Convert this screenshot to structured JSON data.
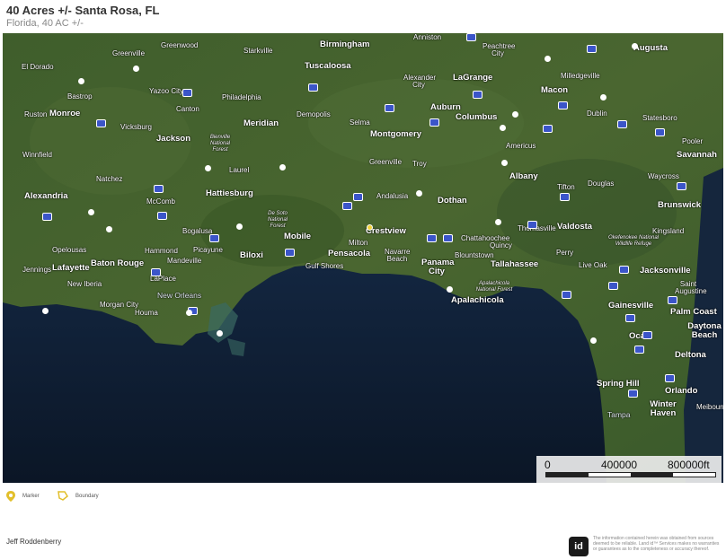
{
  "header": {
    "title": "40 Acres +/- Santa Rosa, FL",
    "subtitle": "Florida, 40 AC +/-"
  },
  "map": {
    "cities_major": [
      {
        "name": "Birmingham"
      },
      {
        "name": "Augusta"
      },
      {
        "name": "Tuscaloosa"
      },
      {
        "name": "LaGrange"
      },
      {
        "name": "Macon"
      },
      {
        "name": "Monroe"
      },
      {
        "name": "Meridian"
      },
      {
        "name": "Auburn"
      },
      {
        "name": "Columbus"
      },
      {
        "name": "Jackson"
      },
      {
        "name": "Montgomery"
      },
      {
        "name": "Savannah"
      },
      {
        "name": "Hattiesburg"
      },
      {
        "name": "Alexandria"
      },
      {
        "name": "Albany"
      },
      {
        "name": "Dothan"
      },
      {
        "name": "Brunswick"
      },
      {
        "name": "Crestview"
      },
      {
        "name": "Mobile"
      },
      {
        "name": "Valdosta"
      },
      {
        "name": "Pensacola"
      },
      {
        "name": "Baton Rouge"
      },
      {
        "name": "Lafayette"
      },
      {
        "name": "Biloxi"
      },
      {
        "name": "Panama City"
      },
      {
        "name": "Tallahassee"
      },
      {
        "name": "Jacksonville"
      },
      {
        "name": "New Orleans"
      },
      {
        "name": "Apalachicola"
      },
      {
        "name": "Gainesville"
      },
      {
        "name": "Palm Coast"
      },
      {
        "name": "Daytona Beach"
      },
      {
        "name": "Ocala"
      },
      {
        "name": "Deltona"
      },
      {
        "name": "Spring Hill"
      },
      {
        "name": "Orlando"
      },
      {
        "name": "Winter Haven"
      },
      {
        "name": "Tampa"
      }
    ],
    "cities_minor": [
      {
        "name": "Anniston"
      },
      {
        "name": "Greenwood"
      },
      {
        "name": "Peachtree City"
      },
      {
        "name": "Greenville"
      },
      {
        "name": "Starkville"
      },
      {
        "name": "El Dorado"
      },
      {
        "name": "Bastrop"
      },
      {
        "name": "Yazoo City"
      },
      {
        "name": "Philadelphia"
      },
      {
        "name": "Canton"
      },
      {
        "name": "Ruston"
      },
      {
        "name": "Vicksburg"
      },
      {
        "name": "Demopolis"
      },
      {
        "name": "Selma"
      },
      {
        "name": "Alexander City"
      },
      {
        "name": "Milledgeville"
      },
      {
        "name": "Dublin"
      },
      {
        "name": "Statesboro"
      },
      {
        "name": "Americus"
      },
      {
        "name": "Pooler"
      },
      {
        "name": "Winnfield"
      },
      {
        "name": "Natchez"
      },
      {
        "name": "Laurel"
      },
      {
        "name": "Greenville"
      },
      {
        "name": "Troy"
      },
      {
        "name": "Tifton"
      },
      {
        "name": "Douglas"
      },
      {
        "name": "Waycross"
      },
      {
        "name": "McComb"
      },
      {
        "name": "Andalusia"
      },
      {
        "name": "Bogalusa"
      },
      {
        "name": "Thomasville"
      },
      {
        "name": "Kingsland"
      },
      {
        "name": "Opelousas"
      },
      {
        "name": "Hammond"
      },
      {
        "name": "Picayune"
      },
      {
        "name": "Milton"
      },
      {
        "name": "Chattahoochee"
      },
      {
        "name": "Quincy"
      },
      {
        "name": "Mandeville"
      },
      {
        "name": "Navarre Beach"
      },
      {
        "name": "Jennings"
      },
      {
        "name": "Gulf Shores"
      },
      {
        "name": "Blountstown"
      },
      {
        "name": "Perry"
      },
      {
        "name": "Live Oak"
      },
      {
        "name": "New Iberia"
      },
      {
        "name": "LaPlace"
      },
      {
        "name": "Saint Augustine"
      },
      {
        "name": "Morgan City"
      },
      {
        "name": "Houma"
      },
      {
        "name": "Meibourne"
      },
      {
        "name": "De Soto National Forest"
      },
      {
        "name": "Bienville National Forest"
      },
      {
        "name": "Apalachicola National Forest"
      },
      {
        "name": "Okefenokee National Wildlife Refuge"
      }
    ],
    "property_marker": "Santa Rosa",
    "scale": {
      "labels": [
        "0",
        "400000",
        "800000ft"
      ]
    }
  },
  "legend": [
    {
      "icon": "map-pin-icon",
      "label": "Marker",
      "color": "#e2bf2b"
    },
    {
      "icon": "boundary-icon",
      "label": "Boundary",
      "color": "#e2bf2b"
    }
  ],
  "footer": {
    "agent": "Jeff Roddenberry",
    "logo": "id",
    "disclaimer": "The information contained herein was obtained from sources deemed to be reliable. Land id™ Services makes no warranties or guarantees as to the completeness or accuracy thereof."
  },
  "colors": {
    "land": "#3d5a2a",
    "water": "#0e1a2c",
    "marker": "#f2d23a",
    "interstate": "#3b55c9"
  }
}
